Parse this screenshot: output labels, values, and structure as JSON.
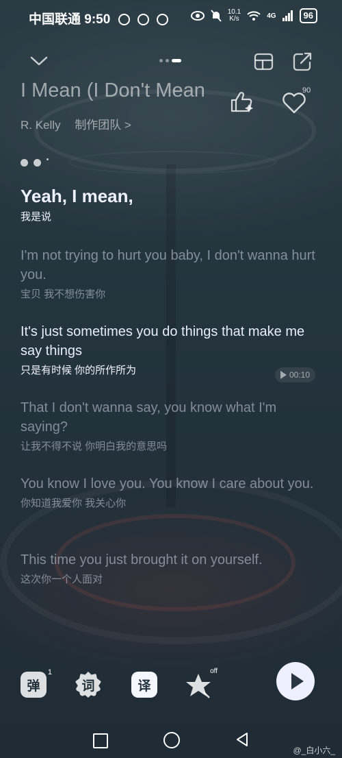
{
  "status_bar": {
    "carrier_time": "中国联通 9:50",
    "net_speed_value": "10.1",
    "net_speed_unit": "K/s",
    "network": "4G",
    "battery": "96"
  },
  "song": {
    "title": "I Mean (I Don't Mean",
    "artist": "R. Kelly",
    "credits_link": "制作团队 >",
    "like_count": "90"
  },
  "lyrics": [
    {
      "en": "Yeah, I mean,",
      "zh": "我是说"
    },
    {
      "en": "I'm not trying to hurt you baby, I don't wanna hurt you.",
      "zh": "宝贝 我不想伤害你"
    },
    {
      "en": "It's just sometimes you do things that make me say things",
      "zh": "只是有时候 你的所作所为"
    },
    {
      "en": "That I don't wanna say, you know what I'm saying?",
      "zh": "让我不得不说 你明白我的意思吗"
    },
    {
      "en": "You know I love you. You know I care about you.",
      "zh": "你知道我爱你 我关心你"
    },
    {
      "en": "This time you just brought it on yourself.",
      "zh": "这次你一个人面对"
    }
  ],
  "seek_time": "00:10",
  "controls": {
    "danmu_label": "弹",
    "danmu_count": "1",
    "ci_label": "词",
    "translate_label": "译",
    "effect_state": "off"
  },
  "watermark": "@_白小六_",
  "colors": {
    "background": "#24343d",
    "play_button": "#eef0ff"
  }
}
